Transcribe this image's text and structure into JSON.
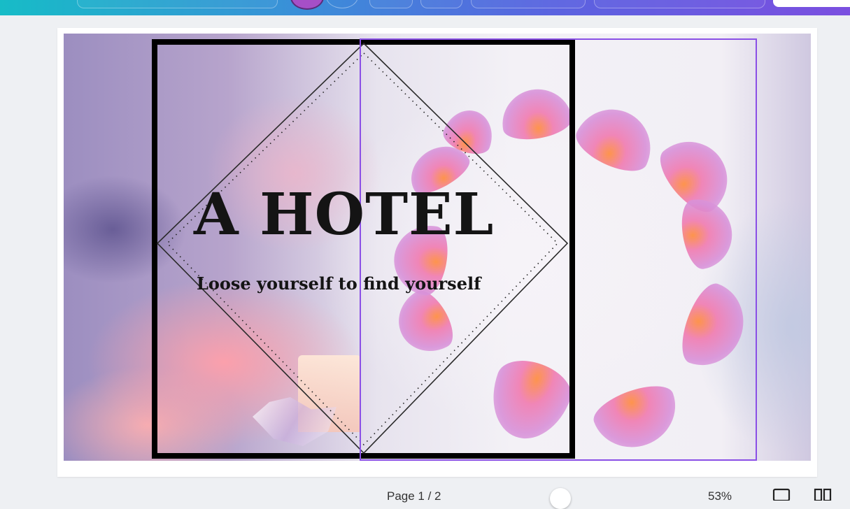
{
  "design": {
    "title": "A HOTEL",
    "subtitle": "Loose yourself to find yourself"
  },
  "footer": {
    "page_indicator": "Page 1 / 2",
    "zoom_level": "53%"
  },
  "colors": {
    "selection_outline": "#8a4fe6",
    "frame_border": "#000000",
    "toolbar_gradient_start": "#17bcc7",
    "toolbar_gradient_end": "#7b4fe0"
  },
  "icons": [
    "grid-view-icon",
    "page-view-icon"
  ]
}
